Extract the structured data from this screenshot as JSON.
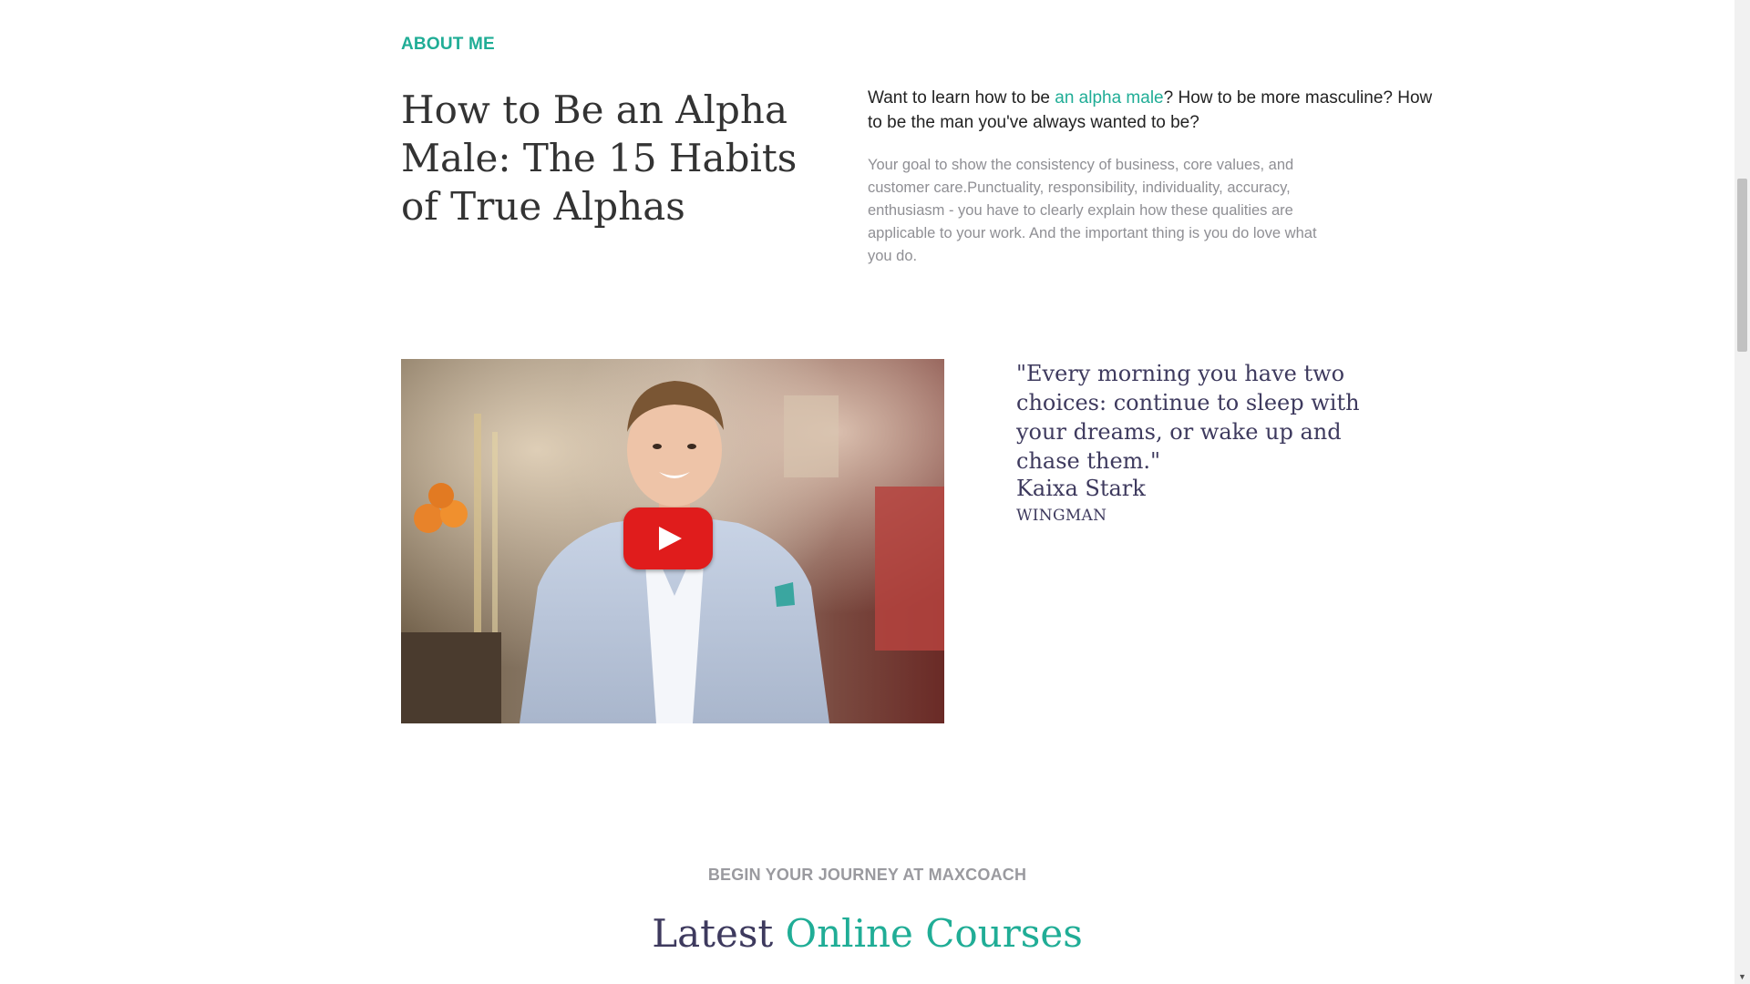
{
  "about": {
    "eyebrow": "ABOUT ME",
    "title": "How to Be an Alpha Male: The 15 Habits of True Alphas",
    "lead_before": "Want to learn how to be ",
    "lead_link": "an alpha male",
    "lead_after": "? How to be more masculine? How to be the man you've always wanted to be?",
    "body": "Your goal to show the consistency of business, core values, and customer care.Punctuality, responsibility, individuality, accuracy, enthusiasm - you have to clearly explain how these qualities are applicable to your work. And the important thing is you do love what you do."
  },
  "video": {
    "play_icon": "youtube-play-icon",
    "play_color": "#e01c1c"
  },
  "quote": {
    "text": "\"Every morning you have two choices: continue to sleep with your dreams, or wake up and chase them.\"",
    "author": "Kaixa Stark",
    "role": "WINGMAN"
  },
  "courses": {
    "eyebrow": "BEGIN YOUR JOURNEY AT MAXCOACH",
    "title_part1": "Latest ",
    "title_part2": "Online Courses"
  },
  "colors": {
    "accent": "#20ad96",
    "heading_dark": "#3e3a5e",
    "muted_text": "#8f8f94"
  }
}
